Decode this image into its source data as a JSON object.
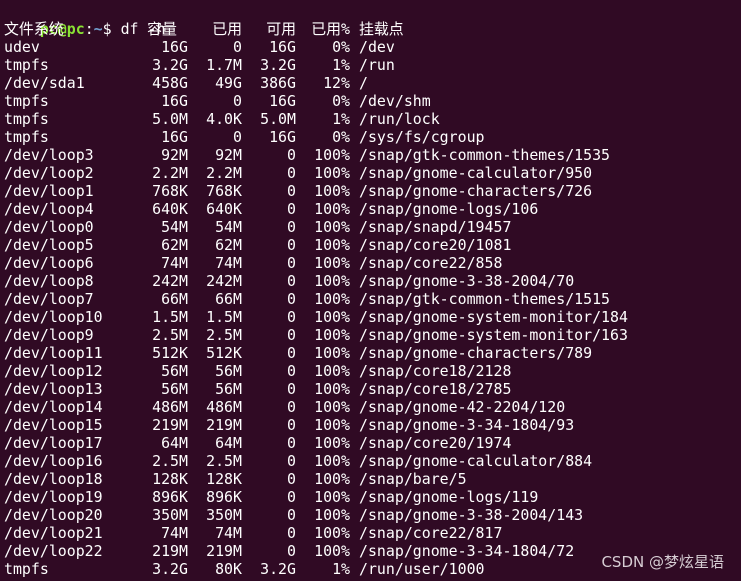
{
  "prompt": {
    "user": "pc@pc",
    "sep": ":",
    "path": "~",
    "symbol": "$ ",
    "command": "df -h"
  },
  "header": {
    "filesystem": "文件系统",
    "size": "容量",
    "used": "已用",
    "avail": "可用",
    "use_pct": "已用%",
    "mounted_on": "挂载点"
  },
  "rows": [
    {
      "fs": "udev",
      "size": "16G",
      "used": "0",
      "avail": "16G",
      "pct": "0%",
      "mount": "/dev"
    },
    {
      "fs": "tmpfs",
      "size": "3.2G",
      "used": "1.7M",
      "avail": "3.2G",
      "pct": "1%",
      "mount": "/run"
    },
    {
      "fs": "/dev/sda1",
      "size": "458G",
      "used": "49G",
      "avail": "386G",
      "pct": "12%",
      "mount": "/"
    },
    {
      "fs": "tmpfs",
      "size": "16G",
      "used": "0",
      "avail": "16G",
      "pct": "0%",
      "mount": "/dev/shm"
    },
    {
      "fs": "tmpfs",
      "size": "5.0M",
      "used": "4.0K",
      "avail": "5.0M",
      "pct": "1%",
      "mount": "/run/lock"
    },
    {
      "fs": "tmpfs",
      "size": "16G",
      "used": "0",
      "avail": "16G",
      "pct": "0%",
      "mount": "/sys/fs/cgroup"
    },
    {
      "fs": "/dev/loop3",
      "size": "92M",
      "used": "92M",
      "avail": "0",
      "pct": "100%",
      "mount": "/snap/gtk-common-themes/1535"
    },
    {
      "fs": "/dev/loop2",
      "size": "2.2M",
      "used": "2.2M",
      "avail": "0",
      "pct": "100%",
      "mount": "/snap/gnome-calculator/950"
    },
    {
      "fs": "/dev/loop1",
      "size": "768K",
      "used": "768K",
      "avail": "0",
      "pct": "100%",
      "mount": "/snap/gnome-characters/726"
    },
    {
      "fs": "/dev/loop4",
      "size": "640K",
      "used": "640K",
      "avail": "0",
      "pct": "100%",
      "mount": "/snap/gnome-logs/106"
    },
    {
      "fs": "/dev/loop0",
      "size": "54M",
      "used": "54M",
      "avail": "0",
      "pct": "100%",
      "mount": "/snap/snapd/19457"
    },
    {
      "fs": "/dev/loop5",
      "size": "62M",
      "used": "62M",
      "avail": "0",
      "pct": "100%",
      "mount": "/snap/core20/1081"
    },
    {
      "fs": "/dev/loop6",
      "size": "74M",
      "used": "74M",
      "avail": "0",
      "pct": "100%",
      "mount": "/snap/core22/858"
    },
    {
      "fs": "/dev/loop8",
      "size": "242M",
      "used": "242M",
      "avail": "0",
      "pct": "100%",
      "mount": "/snap/gnome-3-38-2004/70"
    },
    {
      "fs": "/dev/loop7",
      "size": "66M",
      "used": "66M",
      "avail": "0",
      "pct": "100%",
      "mount": "/snap/gtk-common-themes/1515"
    },
    {
      "fs": "/dev/loop10",
      "size": "1.5M",
      "used": "1.5M",
      "avail": "0",
      "pct": "100%",
      "mount": "/snap/gnome-system-monitor/184"
    },
    {
      "fs": "/dev/loop9",
      "size": "2.5M",
      "used": "2.5M",
      "avail": "0",
      "pct": "100%",
      "mount": "/snap/gnome-system-monitor/163"
    },
    {
      "fs": "/dev/loop11",
      "size": "512K",
      "used": "512K",
      "avail": "0",
      "pct": "100%",
      "mount": "/snap/gnome-characters/789"
    },
    {
      "fs": "/dev/loop12",
      "size": "56M",
      "used": "56M",
      "avail": "0",
      "pct": "100%",
      "mount": "/snap/core18/2128"
    },
    {
      "fs": "/dev/loop13",
      "size": "56M",
      "used": "56M",
      "avail": "0",
      "pct": "100%",
      "mount": "/snap/core18/2785"
    },
    {
      "fs": "/dev/loop14",
      "size": "486M",
      "used": "486M",
      "avail": "0",
      "pct": "100%",
      "mount": "/snap/gnome-42-2204/120"
    },
    {
      "fs": "/dev/loop15",
      "size": "219M",
      "used": "219M",
      "avail": "0",
      "pct": "100%",
      "mount": "/snap/gnome-3-34-1804/93"
    },
    {
      "fs": "/dev/loop17",
      "size": "64M",
      "used": "64M",
      "avail": "0",
      "pct": "100%",
      "mount": "/snap/core20/1974"
    },
    {
      "fs": "/dev/loop16",
      "size": "2.5M",
      "used": "2.5M",
      "avail": "0",
      "pct": "100%",
      "mount": "/snap/gnome-calculator/884"
    },
    {
      "fs": "/dev/loop18",
      "size": "128K",
      "used": "128K",
      "avail": "0",
      "pct": "100%",
      "mount": "/snap/bare/5"
    },
    {
      "fs": "/dev/loop19",
      "size": "896K",
      "used": "896K",
      "avail": "0",
      "pct": "100%",
      "mount": "/snap/gnome-logs/119"
    },
    {
      "fs": "/dev/loop20",
      "size": "350M",
      "used": "350M",
      "avail": "0",
      "pct": "100%",
      "mount": "/snap/gnome-3-38-2004/143"
    },
    {
      "fs": "/dev/loop21",
      "size": "74M",
      "used": "74M",
      "avail": "0",
      "pct": "100%",
      "mount": "/snap/core22/817"
    },
    {
      "fs": "/dev/loop22",
      "size": "219M",
      "used": "219M",
      "avail": "0",
      "pct": "100%",
      "mount": "/snap/gnome-3-34-1804/72"
    },
    {
      "fs": "tmpfs",
      "size": "3.2G",
      "used": "80K",
      "avail": "3.2G",
      "pct": "1%",
      "mount": "/run/user/1000"
    }
  ],
  "watermark": "CSDN @梦炫星语",
  "colors": {
    "background": "#300a24",
    "text": "#ffffff",
    "prompt_user": "#8ae234",
    "prompt_path": "#729fcf"
  }
}
